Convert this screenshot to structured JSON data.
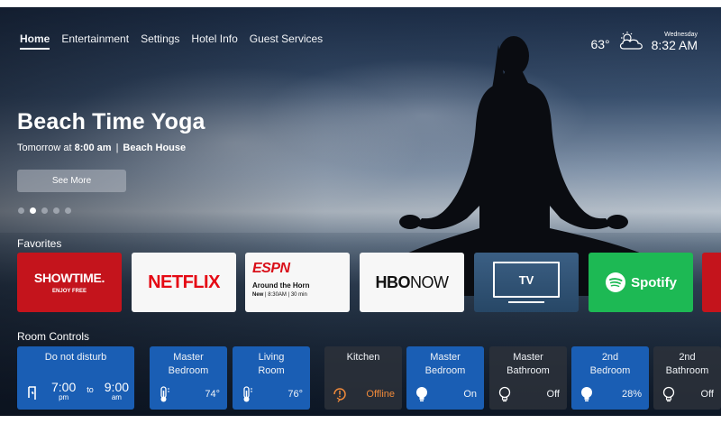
{
  "nav": {
    "items": [
      "Home",
      "Entertainment",
      "Settings",
      "Hotel Info",
      "Guest Services"
    ],
    "active": "Home"
  },
  "weather": {
    "temperature": "63°",
    "icon": "partly-cloudy-icon",
    "day": "Wednesday",
    "time": "8:32 AM"
  },
  "hero": {
    "title": "Beach Time Yoga",
    "when_prefix": "Tomorrow at ",
    "when_time": "8:00 am",
    "separator": "|",
    "location": "Beach House",
    "button": "See More",
    "carousel_count": 5,
    "carousel_active": 2
  },
  "favorites": {
    "label": "Favorites",
    "items": [
      {
        "id": "showtime",
        "logo": "SHOWTIME.",
        "subtitle": "ENJOY FREE"
      },
      {
        "id": "netflix",
        "logo": "NETFLIX"
      },
      {
        "id": "espn",
        "logo": "ESPN",
        "show": "Around the Horn",
        "meta_new": "New",
        "meta_time": "8:30AM",
        "meta_duration": "30 min"
      },
      {
        "id": "hbo",
        "logo_bold": "HBO",
        "logo_rest": "NOW"
      },
      {
        "id": "tv",
        "label": "TV"
      },
      {
        "id": "spotify",
        "label": "Spotify"
      }
    ]
  },
  "room_controls": {
    "label": "Room Controls",
    "dnd": {
      "title": "Do not disturb",
      "from_time": "7:00",
      "from_ampm": "pm",
      "to": "to",
      "to_time": "9:00",
      "to_ampm": "am"
    },
    "items": [
      {
        "title_1": "Master",
        "title_2": "Bedroom",
        "icon": "thermometer-icon",
        "value": "74°",
        "state": "on"
      },
      {
        "title_1": "Living",
        "title_2": "Room",
        "icon": "thermometer-icon",
        "value": "76°",
        "state": "on"
      },
      {
        "title_1": "Kitchen",
        "title_2": "",
        "icon": "warning-clock-icon",
        "value": "Offline",
        "state": "off"
      },
      {
        "title_1": "Master",
        "title_2": "Bedroom",
        "icon": "lightbulb-icon",
        "value": "On",
        "state": "on"
      },
      {
        "title_1": "Master",
        "title_2": "Bathroom",
        "icon": "lightbulb-outline-icon",
        "value": "Off",
        "state": "off"
      },
      {
        "title_1": "2nd",
        "title_2": "Bedroom",
        "icon": "lightbulb-icon",
        "value": "28%",
        "state": "on"
      },
      {
        "title_1": "2nd",
        "title_2": "Bathroom",
        "icon": "lightbulb-outline-icon",
        "value": "Off",
        "state": "off"
      }
    ]
  },
  "colors": {
    "accent_blue": "#1a5eb4",
    "offline_orange": "#f08a3a",
    "showtime_red": "#c4141c",
    "netflix_red": "#e50914",
    "spotify_green": "#1db954"
  }
}
